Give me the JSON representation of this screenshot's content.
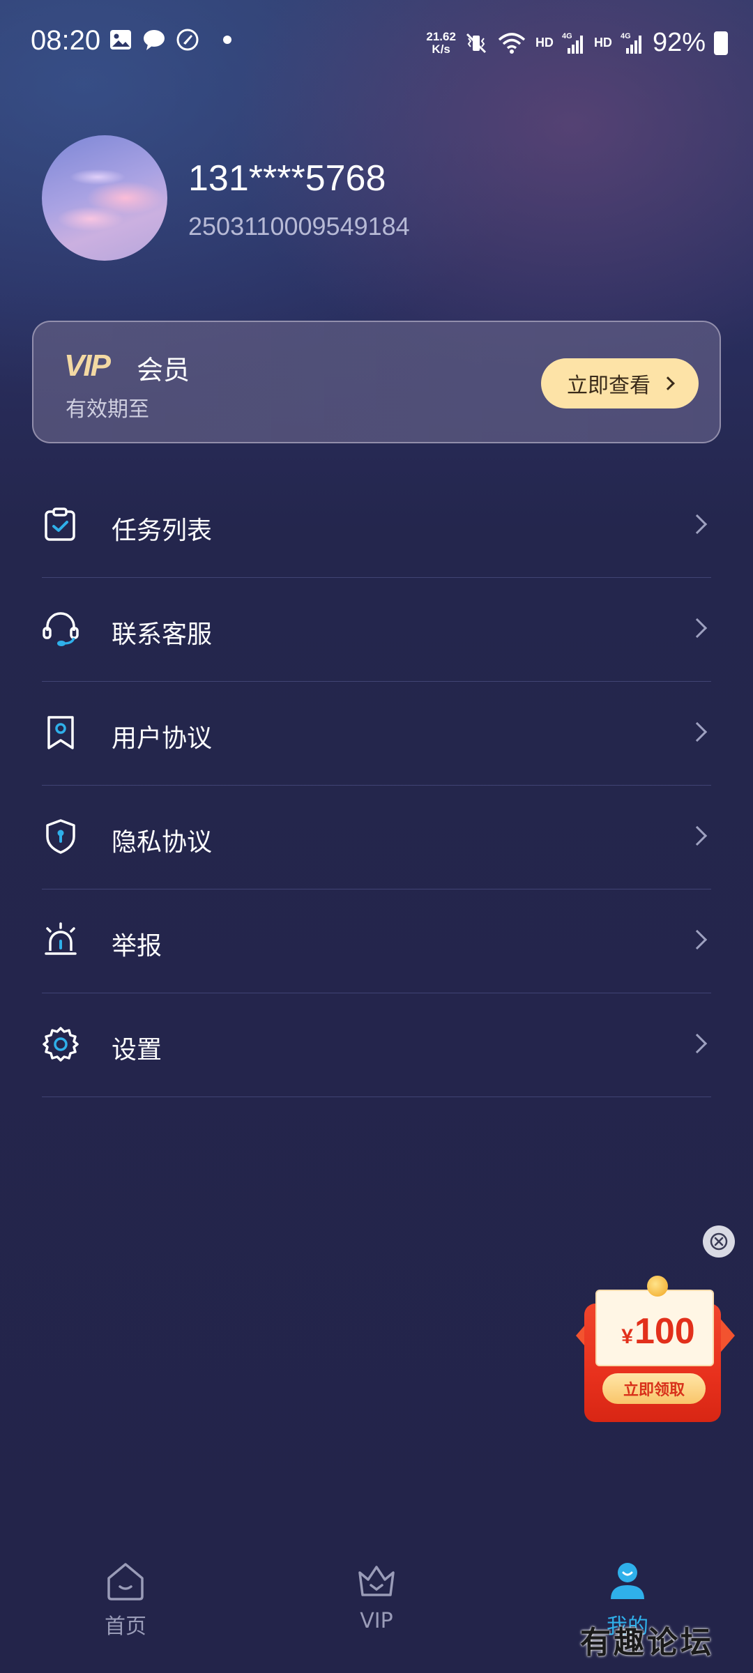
{
  "status_bar": {
    "time": "08:20",
    "net_speed_value": "21.62",
    "net_speed_unit": "K/s",
    "hd1": "HD",
    "hd2": "HD",
    "net1": "4G",
    "net2": "4G",
    "battery": "92%"
  },
  "profile": {
    "phone": "131****5768",
    "uid": "2503110009549184"
  },
  "vip_card": {
    "logo": "VIP",
    "title": "会员",
    "subtitle": "有效期至",
    "button": "立即查看"
  },
  "menu": [
    {
      "label": "任务列表",
      "icon": "task-clipboard-icon"
    },
    {
      "label": "联系客服",
      "icon": "headset-icon"
    },
    {
      "label": "用户协议",
      "icon": "bookmark-icon"
    },
    {
      "label": "隐私协议",
      "icon": "shield-icon"
    },
    {
      "label": "举报",
      "icon": "alarm-icon"
    },
    {
      "label": "设置",
      "icon": "gear-icon"
    }
  ],
  "promo": {
    "currency": "¥",
    "amount": "100",
    "button": "立即领取"
  },
  "bottom_nav": [
    {
      "label": "首页",
      "icon": "home-icon",
      "active": false
    },
    {
      "label": "VIP",
      "icon": "crown-icon",
      "active": false
    },
    {
      "label": "我的",
      "icon": "user-icon",
      "active": true
    }
  ],
  "watermark": "有趣论坛",
  "colors": {
    "accent": "#2fb0ea",
    "vip_gold": "#f3d9a3",
    "vip_button_bg": "#fde3a7",
    "background": "#23244a"
  }
}
